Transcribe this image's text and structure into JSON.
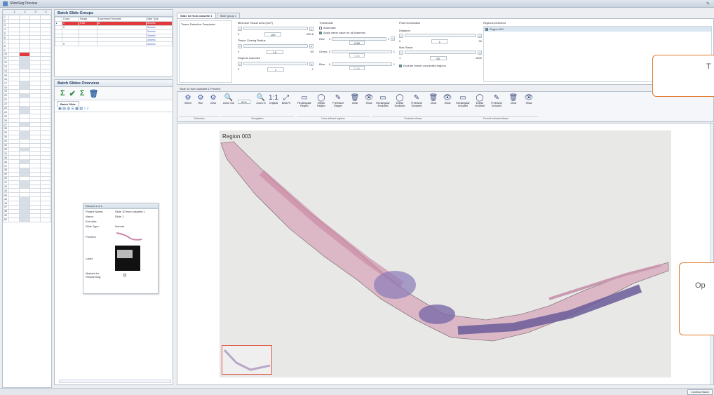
{
  "app": {
    "title": "SlideSeg Preview"
  },
  "left_grid": {
    "columns": [
      "1",
      "2",
      "3",
      "4"
    ],
    "rows": [
      "1",
      "2",
      "3",
      "4",
      "5",
      "6",
      "7",
      "8",
      "9",
      "10",
      "11",
      "12",
      "13",
      "14",
      "15",
      "16",
      "17",
      "18",
      "19",
      "20",
      "21",
      "22",
      "23",
      "24",
      "25",
      "26",
      "27",
      "28",
      "29",
      "30",
      "31",
      "32",
      "33",
      "34",
      "35",
      "36",
      "37",
      "38",
      "39",
      "40",
      "41",
      "42",
      "43",
      "44",
      "45",
      "46",
      "47",
      "48",
      "49",
      "50"
    ]
  },
  "batch_groups": {
    "title": "Batch Slide Groups",
    "columns": [
      "",
      "Count",
      "Range",
      "Experiment Template",
      "Slide Type"
    ],
    "rows": [
      {
        "count": "1",
        "range": "9-50",
        "template": "A",
        "type": "Generic"
      },
      {
        "count": "0",
        "range": "",
        "template": "",
        "type": "Generic"
      },
      {
        "count": "",
        "range": "",
        "template": "",
        "type": "Generic"
      },
      {
        "count": "",
        "range": "",
        "template": "",
        "type": "Generic"
      },
      {
        "count": "",
        "range": "",
        "template": "",
        "type": "Generic"
      },
      {
        "count": "0",
        "range": "",
        "template": "",
        "type": "Generic"
      }
    ]
  },
  "overview": {
    "title": "Batch Slides Overview",
    "tab": "Batch Slide"
  },
  "record": {
    "header": "Record 1 of 1",
    "fields": [
      {
        "label": "Project Name:",
        "value": "Slide 10 from cassette 1"
      },
      {
        "label": "Name:",
        "value": "Slide 1"
      },
      {
        "label": "Ext slide:",
        "value": ""
      },
      {
        "label": "Slide Type:",
        "value": "Normal"
      },
      {
        "label": "Preview:",
        "value": ""
      },
      {
        "label": "Label:",
        "value": ""
      },
      {
        "label": "Marked for Rescanning:",
        "value": ""
      }
    ]
  },
  "tabs": [
    "Slide 10 from cassette 1",
    "Slide group 1"
  ],
  "settings": {
    "template_label": "Tissue Detection Templates",
    "min_area_label": "Minimum Tissue Area (mm²)",
    "min_area_vals": [
      "0",
      "100",
      "259.6"
    ],
    "closing_label": "Tissue Closing Radius",
    "closing_vals": [
      "0",
      "10",
      "50"
    ],
    "regions_expected_label": "Regions expected",
    "regions_expected_vals": [
      "0",
      "1",
      "1"
    ],
    "thresholds_label": "Thresholds",
    "automatic_label": "Automatic",
    "apply_label": "Apply same value for all channels",
    "red_label": "Red:",
    "green_label": "Green:",
    "blue_label": "Blue:",
    "red_vals": [
      "0",
      "0.88",
      "1"
    ],
    "green_vals": [
      "0",
      "0.45",
      "1"
    ],
    "blue_vals": [
      "0",
      "0.45",
      "1"
    ],
    "point_gen_label": "Point Generation",
    "distance_label": "Distance:",
    "distance_vals": [
      "0",
      "1",
      "30"
    ],
    "max_steps_label": "Max Steps:",
    "max_steps_vals": [
      "1",
      "50",
      "1000"
    ],
    "exclude_label": "Exclude border connected regions",
    "regions_detected_label": "Regions Detected",
    "regions_detected_items": [
      "Region 001"
    ]
  },
  "viewer": {
    "title": "Slide 10 from cassette 1 Preview",
    "zoom": "61%",
    "region_label": "Region 003"
  },
  "toolbar": {
    "buttons": [
      "Select",
      "Run",
      "Clear",
      "Zoom Out",
      "Zoom In",
      "Original",
      "Best-Fit",
      "Rectangular Region",
      "Elliptic Region",
      "Freehand Region",
      "Clear",
      "Show",
      "Rectangular Excluded",
      "Elliptic Excluded",
      "Freehand Excluded",
      "Clear",
      "Show",
      "Rectangular Included",
      "Elliptic Included",
      "Freehand Included",
      "Clear",
      "Show"
    ],
    "groups": [
      "Detection",
      "Navigation",
      "User defined regions",
      "Excluded Areas",
      "Forced Included Areas"
    ]
  },
  "callouts": {
    "top": "T",
    "bottom": "Op"
  },
  "footer": {
    "button": "Continue Batch"
  }
}
